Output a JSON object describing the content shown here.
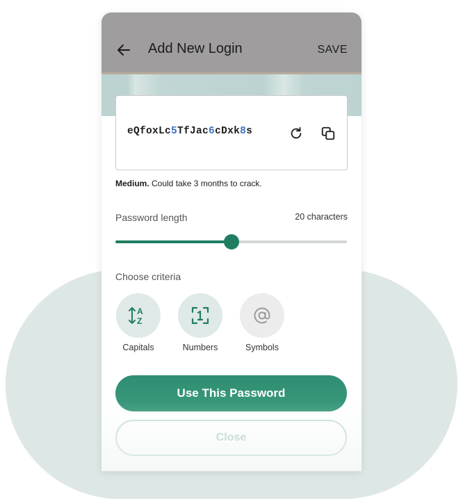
{
  "header": {
    "title": "Add New Login",
    "save_label": "SAVE"
  },
  "password": {
    "segments": [
      {
        "text": "eQfoxLc",
        "digit": false
      },
      {
        "text": "5",
        "digit": true
      },
      {
        "text": "TfJac",
        "digit": false
      },
      {
        "text": "6",
        "digit": true
      },
      {
        "text": "cDxk",
        "digit": false
      },
      {
        "text": "8",
        "digit": true
      },
      {
        "text": "s",
        "digit": false
      }
    ],
    "strength_level": "Medium.",
    "strength_detail": " Could take 3 months to crack."
  },
  "length": {
    "label": "Password length",
    "value_text": "20 characters",
    "value": 20,
    "fraction": 0.5
  },
  "criteria": {
    "label": "Choose criteria",
    "items": [
      {
        "label": "Capitals",
        "icon": "sort-alpha-icon",
        "selected": true
      },
      {
        "label": "Numbers",
        "icon": "number-one-icon",
        "selected": true
      },
      {
        "label": "Symbols",
        "icon": "at-sign-icon",
        "selected": false
      }
    ]
  },
  "actions": {
    "primary_label": "Use This Password",
    "secondary_label": "Close"
  },
  "colors": {
    "accent": "#1f7d62",
    "header_bg": "#9f9d9e",
    "digit": "#3a6fc4",
    "backdrop": "#dde8e6"
  }
}
